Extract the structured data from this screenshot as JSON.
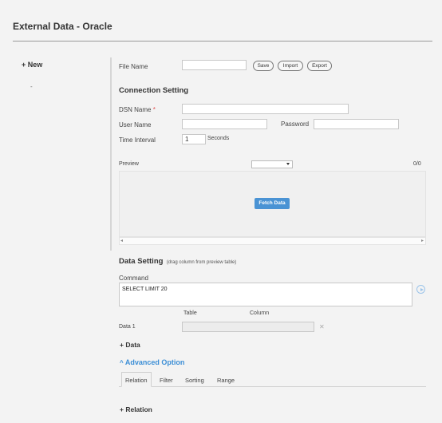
{
  "page": {
    "title": "External Data - Oracle"
  },
  "sidebar": {
    "new_label": "+ New",
    "dash": "-"
  },
  "file": {
    "label": "File Name",
    "value": "",
    "save": "Save",
    "import": "Import",
    "export": "Export"
  },
  "connection": {
    "heading": "Connection Setting",
    "dsn_label": "DSN Name",
    "required_mark": "*",
    "user_label": "User Name",
    "password_label": "Password",
    "interval_label": "Time Interval",
    "interval_value": "1",
    "interval_unit": "Seconds"
  },
  "preview": {
    "label": "Preview",
    "count": "0/0",
    "fetch_button": "Fetch Data",
    "scroll_left": "◂",
    "scroll_right": "▸"
  },
  "data_setting": {
    "heading": "Data Setting",
    "hint": "(drag column from preview table)",
    "command_label": "Command",
    "command_value": "SELECT LIMIT 20",
    "col_table": "Table",
    "col_column": "Column",
    "row_label": "Data 1",
    "remove": "✕",
    "add_data": "+ Data"
  },
  "advanced": {
    "label": "Advanced Option",
    "tabs": [
      "Relation",
      "Filter",
      "Sorting",
      "Range"
    ],
    "active_tab": "Relation",
    "add_relation": "+ Relation"
  },
  "colors": {
    "accent": "#4a93d4",
    "link": "#3d8fd6",
    "required": "#e05050"
  }
}
